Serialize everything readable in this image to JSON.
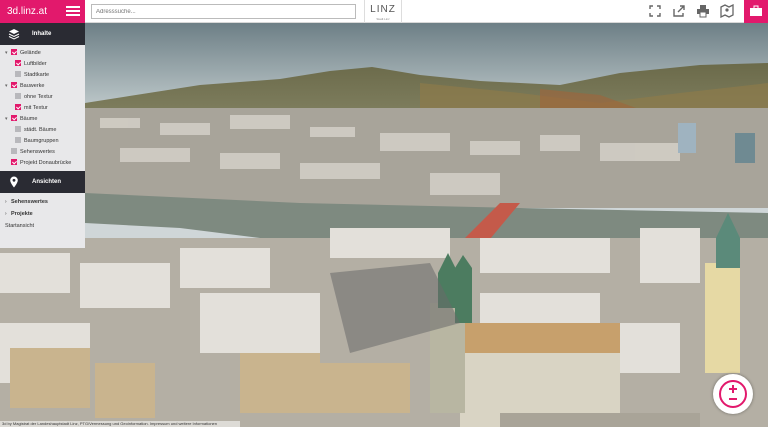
{
  "brand": {
    "title": "3d.linz.at",
    "color": "#e2196c"
  },
  "search": {
    "placeholder": "Adresssuche..."
  },
  "logo": {
    "text": "LINZ",
    "subtext": "Stadt Linz"
  },
  "toolbar": {
    "icons": [
      "fullscreen-icon",
      "share-icon",
      "print-icon",
      "map-icon",
      "toolbox-icon"
    ]
  },
  "sidebar": {
    "contents_title": "Inhalte",
    "tree": [
      {
        "label": "Gelände",
        "checked": true,
        "level": 1
      },
      {
        "label": "Luftbilder",
        "checked": true,
        "level": 2
      },
      {
        "label": "Stadtkarte",
        "checked": false,
        "level": 2
      },
      {
        "label": "Bauwerke",
        "checked": true,
        "level": 1
      },
      {
        "label": "ohne Textur",
        "checked": false,
        "level": 2
      },
      {
        "label": "mit Textur",
        "checked": true,
        "level": 2
      },
      {
        "label": "Bäume",
        "checked": true,
        "level": 1
      },
      {
        "label": "städt. Bäume",
        "checked": false,
        "level": 2
      },
      {
        "label": "Baumgruppen",
        "checked": false,
        "level": 2
      },
      {
        "label": "Sehenswertes",
        "checked": false,
        "level": 0
      },
      {
        "label": "Projekt Donaubrücke",
        "checked": true,
        "level": 0
      }
    ],
    "views_title": "Ansichten",
    "views": [
      "Sehenswertes",
      "Projekte",
      "Startansicht"
    ]
  },
  "credit": {
    "text": "3d by Magistrat der Landeshauptstadt Linz, PTG/Vermessung und Geoinformation. Impressum und weitere Informationen"
  }
}
